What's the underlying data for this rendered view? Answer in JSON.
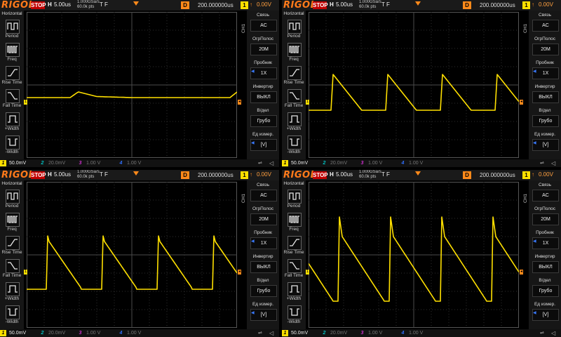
{
  "brand": "RIGOL",
  "status": "STOP",
  "horizontal": {
    "label": "H",
    "value": "5.00us"
  },
  "acq": {
    "rate": "1.000GSa/s",
    "points": "60.0k pts"
  },
  "trigger_flag": "T F",
  "delay": {
    "label": "D",
    "value": "200.000000us"
  },
  "trigger": {
    "source": "1",
    "edge": "↑",
    "level": "0.00V"
  },
  "left_menu": {
    "header": "Horizontal",
    "items": [
      {
        "label": "Period",
        "icon": "period-icon"
      },
      {
        "label": "Freq",
        "icon": "freq-icon"
      },
      {
        "label": "Rise Time",
        "icon": "rise-time-icon"
      },
      {
        "label": "Fall Time",
        "icon": "fall-time-icon"
      },
      {
        "label": "+Width",
        "icon": "plus-width-icon"
      },
      {
        "label": "-Width",
        "icon": "minus-width-icon"
      }
    ]
  },
  "ch1_side_label": "CH1",
  "right_menu": [
    {
      "label": "Связь",
      "value": "AC",
      "arrow": false
    },
    {
      "label": "ОгрПолос",
      "value": "20M",
      "arrow": false
    },
    {
      "label": "Пробник",
      "value": "1X",
      "arrow": true
    },
    {
      "label": "Инвертир",
      "value": "ВЫКЛ",
      "arrow": false
    },
    {
      "label": "В/дел",
      "value": "Грубо",
      "arrow": false
    },
    {
      "label": "Ед измер.",
      "value": "[V]",
      "arrow": true
    }
  ],
  "channels": [
    {
      "num": "1",
      "value": "50.0mV",
      "color": "#ffe000"
    },
    {
      "num": "2",
      "value": "20.0mV",
      "color": "#00c8c8"
    },
    {
      "num": "3",
      "value": "1.00 V",
      "color": "#d030d0"
    },
    {
      "num": "4",
      "value": "1.00 V",
      "color": "#3070ff"
    }
  ],
  "colors": {
    "ch1": "#ffe000",
    "brand": "#ff7a1a",
    "stop": "#c00000",
    "trigger": "#ff8a1a"
  },
  "panels": [
    {
      "id": "top-left",
      "waveform": "flat-with-small-bump"
    },
    {
      "id": "top-right",
      "waveform": "sawtooth-small"
    },
    {
      "id": "bottom-left",
      "waveform": "sawtooth-large"
    },
    {
      "id": "bottom-right",
      "waveform": "sawtooth-spiky"
    }
  ]
}
